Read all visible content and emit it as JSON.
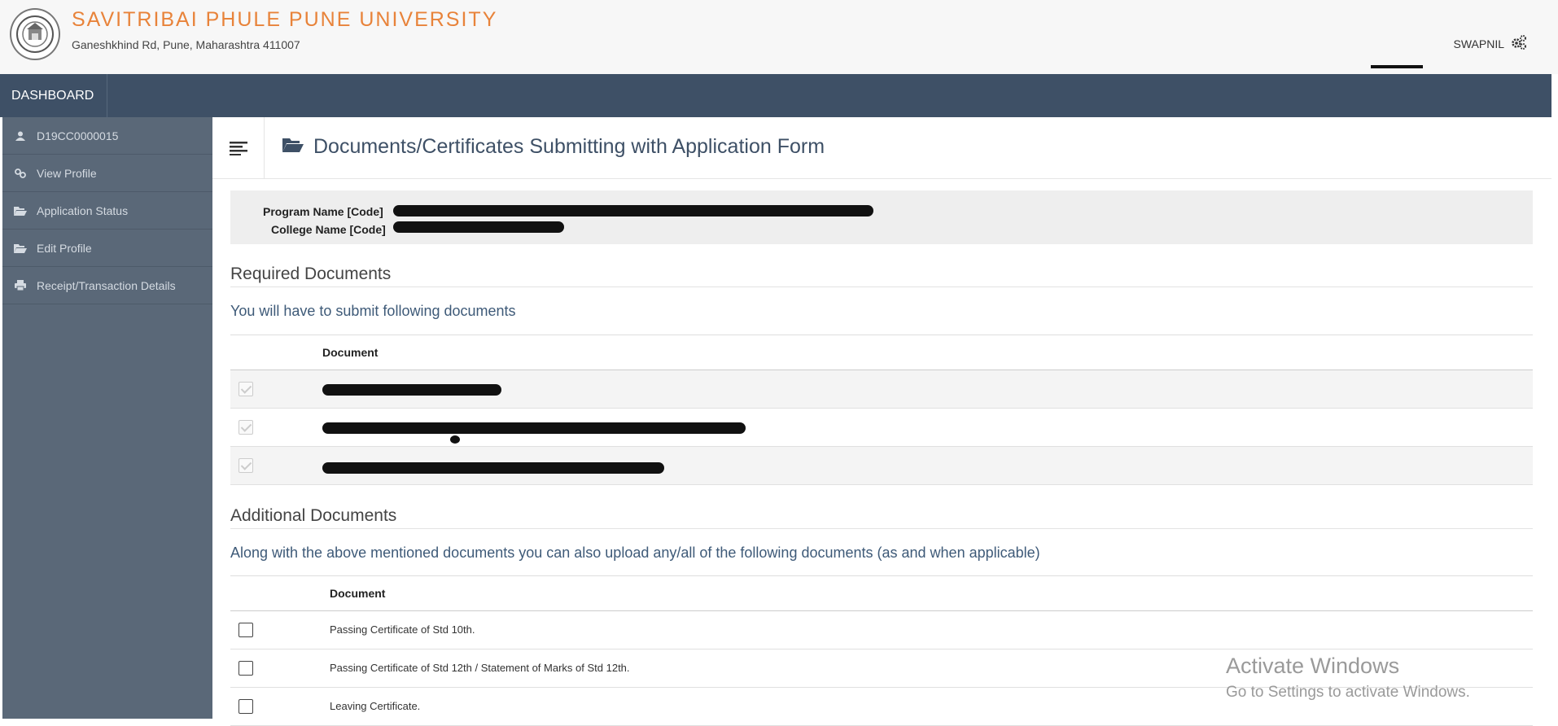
{
  "header": {
    "university_name": "SAVITRIBAI PHULE PUNE UNIVERSITY",
    "address": "Ganeshkhind Rd, Pune, Maharashtra 411007",
    "user_name": "SWAPNIL",
    "logo_icon": "university-seal-icon",
    "settings_icon": "gears-icon"
  },
  "navbar": {
    "dashboard_label": "DASHBOARD"
  },
  "sidebar": {
    "items": [
      {
        "label": "D19CC0000015",
        "icon": "user-icon"
      },
      {
        "label": "View Profile",
        "icon": "link-icon"
      },
      {
        "label": "Application Status",
        "icon": "folder-open-icon"
      },
      {
        "label": "Edit Profile",
        "icon": "folder-open-icon"
      },
      {
        "label": "Receipt/Transaction Details",
        "icon": "print-icon"
      }
    ]
  },
  "main": {
    "title": "Documents/Certificates Submitting with Application Form",
    "info": {
      "program_label": "Program Name [Code]",
      "college_label": "College Name [Code]"
    },
    "required": {
      "title": "Required Documents",
      "subtitle": "You will have to submit following documents",
      "column_header": "Document"
    },
    "additional": {
      "title": "Additional Documents",
      "subtitle": "Along with the above mentioned documents you can also upload any/all of the following documents (as and when applicable)",
      "column_header": "Document",
      "rows": [
        {
          "label": "Passing Certificate of Std 10th.",
          "checked": false
        },
        {
          "label": "Passing Certificate of Std 12th / Statement of Marks of Std 12th.",
          "checked": false
        },
        {
          "label": "Leaving Certificate.",
          "checked": false
        }
      ]
    }
  },
  "watermark": {
    "line1": "Activate Windows",
    "line2": "Go to Settings to activate Windows."
  },
  "colors": {
    "brand_orange": "#e8833a",
    "navbar": "#3e5066",
    "sidebar": "#5a6878"
  }
}
